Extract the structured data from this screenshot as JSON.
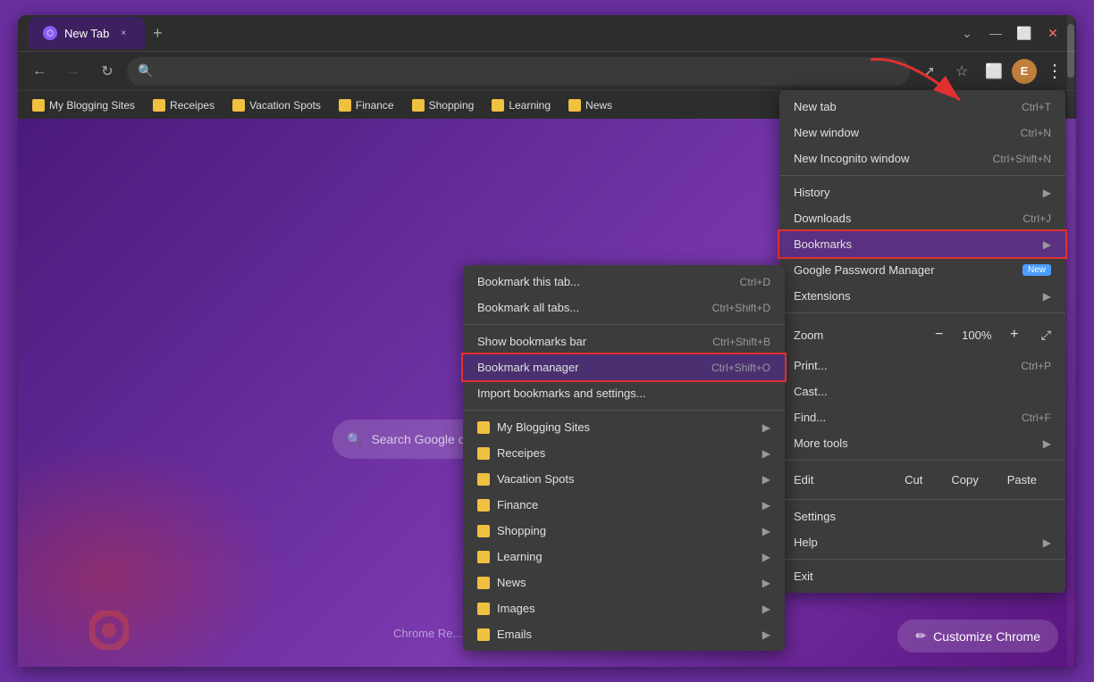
{
  "browser": {
    "title": "New Tab",
    "tab_close": "×",
    "tab_new": "+",
    "window_controls": [
      "—",
      "⬜",
      "×"
    ],
    "tab_dropdown": "⌄"
  },
  "toolbar": {
    "back": "←",
    "forward": "→",
    "reload": "↻",
    "address_placeholder": "",
    "share_icon": "⬆",
    "star_icon": "☆",
    "extension_icon": "⬜",
    "profile_label": "E",
    "menu_icon": "⋮"
  },
  "bookmarks": {
    "items": [
      {
        "label": "My Blogging Sites"
      },
      {
        "label": "Receipes"
      },
      {
        "label": "Vacation Spots"
      },
      {
        "label": "Finance"
      },
      {
        "label": "Shopping"
      },
      {
        "label": "Learning"
      },
      {
        "label": "News"
      }
    ]
  },
  "search": {
    "placeholder": "Search Google or type a URL"
  },
  "customize": {
    "label": "Customize Chrome",
    "pencil": "✏"
  },
  "chrome_menu": {
    "items": [
      {
        "id": "new-tab",
        "label": "New tab",
        "shortcut": "Ctrl+T",
        "arrow": false
      },
      {
        "id": "new-window",
        "label": "New window",
        "shortcut": "Ctrl+N",
        "arrow": false
      },
      {
        "id": "new-incognito",
        "label": "New Incognito window",
        "shortcut": "Ctrl+Shift+N",
        "arrow": false
      },
      {
        "id": "divider1",
        "type": "divider"
      },
      {
        "id": "history",
        "label": "History",
        "shortcut": "",
        "arrow": true
      },
      {
        "id": "downloads",
        "label": "Downloads",
        "shortcut": "Ctrl+J",
        "arrow": false
      },
      {
        "id": "bookmarks",
        "label": "Bookmarks",
        "shortcut": "",
        "arrow": true,
        "highlighted": true
      },
      {
        "id": "password-manager",
        "label": "Google Password Manager",
        "badge": "New",
        "arrow": false
      },
      {
        "id": "extensions",
        "label": "Extensions",
        "shortcut": "",
        "arrow": true
      },
      {
        "id": "divider2",
        "type": "divider"
      },
      {
        "id": "zoom",
        "type": "zoom",
        "label": "Zoom",
        "minus": "−",
        "value": "100%",
        "plus": "+",
        "expand": "⤢"
      },
      {
        "id": "print",
        "label": "Print...",
        "shortcut": "Ctrl+P",
        "arrow": false
      },
      {
        "id": "cast",
        "label": "Cast...",
        "shortcut": "",
        "arrow": false
      },
      {
        "id": "find",
        "label": "Find...",
        "shortcut": "Ctrl+F",
        "arrow": false
      },
      {
        "id": "more-tools",
        "label": "More tools",
        "shortcut": "",
        "arrow": true
      },
      {
        "id": "divider3",
        "type": "divider"
      },
      {
        "id": "edit",
        "type": "edit",
        "label": "Edit",
        "cut": "Cut",
        "copy": "Copy",
        "paste": "Paste"
      },
      {
        "id": "divider4",
        "type": "divider"
      },
      {
        "id": "settings",
        "label": "Settings",
        "shortcut": "",
        "arrow": false
      },
      {
        "id": "help",
        "label": "Help",
        "shortcut": "",
        "arrow": true
      },
      {
        "id": "divider5",
        "type": "divider"
      },
      {
        "id": "exit",
        "label": "Exit",
        "shortcut": "",
        "arrow": false
      }
    ]
  },
  "bookmarks_submenu": {
    "items": [
      {
        "id": "bookmark-tab",
        "label": "Bookmark this tab...",
        "shortcut": "Ctrl+D",
        "arrow": false
      },
      {
        "id": "bookmark-all-tabs",
        "label": "Bookmark all tabs...",
        "shortcut": "Ctrl+Shift+D",
        "arrow": false
      },
      {
        "id": "divider1",
        "type": "divider"
      },
      {
        "id": "show-bookmarks-bar",
        "label": "Show bookmarks bar",
        "shortcut": "Ctrl+Shift+B",
        "arrow": false
      },
      {
        "id": "bookmark-manager",
        "label": "Bookmark manager",
        "shortcut": "Ctrl+Shift+O",
        "arrow": false,
        "highlighted": true
      },
      {
        "id": "import-bookmarks",
        "label": "Import bookmarks and settings...",
        "shortcut": "",
        "arrow": false
      },
      {
        "id": "divider2",
        "type": "divider"
      },
      {
        "id": "my-blogging",
        "label": "My Blogging Sites",
        "shortcut": "",
        "arrow": true,
        "has_icon": true
      },
      {
        "id": "receipes",
        "label": "Receipes",
        "shortcut": "",
        "arrow": true,
        "has_icon": true
      },
      {
        "id": "vacation-spots",
        "label": "Vacation Spots",
        "shortcut": "",
        "arrow": true,
        "has_icon": true
      },
      {
        "id": "finance",
        "label": "Finance",
        "shortcut": "",
        "arrow": true,
        "has_icon": true
      },
      {
        "id": "shopping",
        "label": "Shopping",
        "shortcut": "",
        "arrow": true,
        "has_icon": true
      },
      {
        "id": "learning",
        "label": "Learning",
        "shortcut": "",
        "arrow": true,
        "has_icon": true
      },
      {
        "id": "news",
        "label": "News",
        "shortcut": "",
        "arrow": true,
        "has_icon": true
      },
      {
        "id": "images",
        "label": "Images",
        "shortcut": "",
        "arrow": true,
        "has_icon": true
      },
      {
        "id": "emails",
        "label": "Emails",
        "shortcut": "",
        "arrow": true,
        "has_icon": true
      }
    ]
  }
}
